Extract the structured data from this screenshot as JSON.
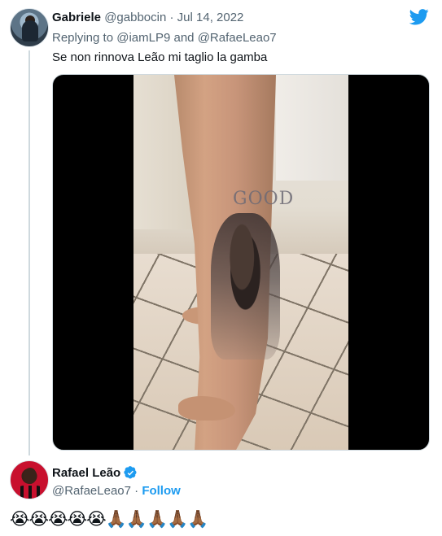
{
  "reply_tweet": {
    "author_name": "Gabriele",
    "author_handle": "@gabbocin",
    "separator": "·",
    "date": "Jul 14, 2022",
    "replying_to_prefix": "Replying to",
    "replying_to_1": "@iamLP9",
    "replying_to_and": "and",
    "replying_to_2": "@RafaeLeao7",
    "text": "Se non rinnova Leão mi taglio la gamba",
    "media": {
      "type": "video",
      "tattoo_text": "GOOD"
    },
    "icon": "twitter-bird-icon"
  },
  "quoted_response": {
    "author_name": "Rafael Leão",
    "verified": true,
    "author_handle": "@RafaeLeao7",
    "separator": "·",
    "follow_label": "Follow",
    "text": "😭😭😭😭😭🙏🏾🙏🏾🙏🏾🙏🏾🙏🏾"
  },
  "colors": {
    "accent": "#1d9bf0",
    "muted": "#536471",
    "text": "#0f1419"
  }
}
